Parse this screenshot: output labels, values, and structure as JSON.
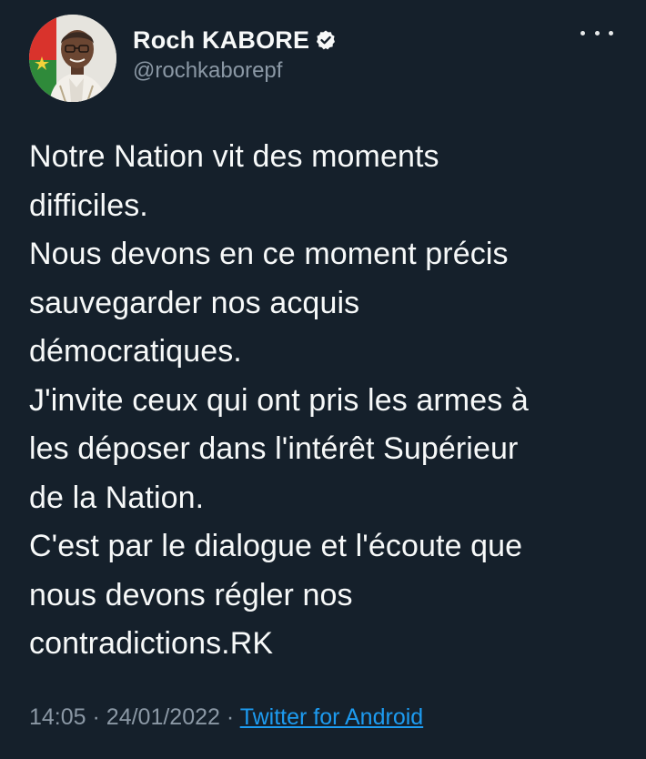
{
  "author": {
    "display_name": "Roch KABORE",
    "handle": "@rochkaborepf",
    "verified": true,
    "avatar_icon": "profile-photo"
  },
  "menu_icon": "more-options-icon",
  "tweet": {
    "text": "Notre Nation vit des moments\ndifficiles.\nNous devons en ce moment précis\nsauvegarder nos acquis\ndémocratiques.\nJ'invite ceux qui ont pris les armes à\nles déposer dans l'intérêt Supérieur\nde la Nation.\nC'est par le dialogue et l'écoute que\nnous devons régler nos\ncontradictions.RK",
    "time": "14:05",
    "separator": "·",
    "date": "24/01/2022",
    "source": "Twitter for Android"
  },
  "colors": {
    "background": "#15202b",
    "text": "#f7f9f9",
    "secondary_text": "#8b98a5",
    "link": "#1d9bf0"
  }
}
